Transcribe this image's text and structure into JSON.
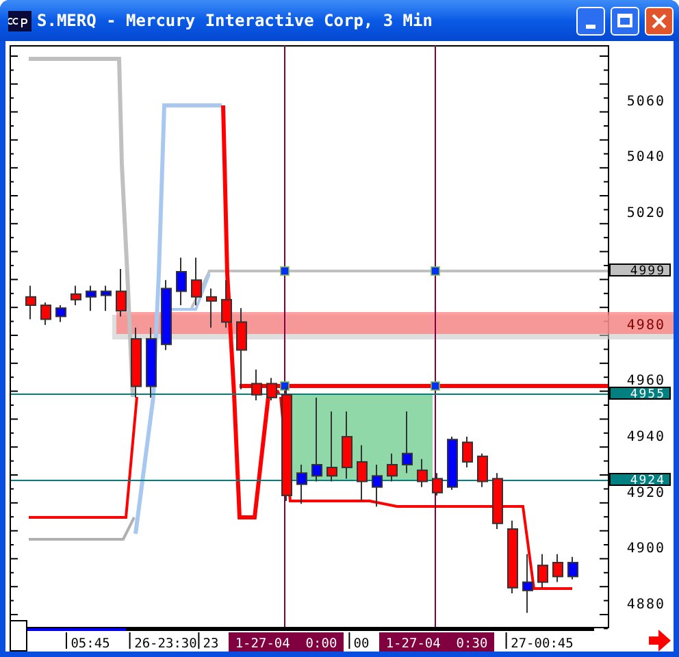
{
  "window": {
    "title": "S.MERQ - Mercury Interactive Corp, 3 Min"
  },
  "chart": {
    "chart_data": {
      "type": "candlestick",
      "categories": [
        null,
        null,
        null,
        null,
        "05:45",
        null,
        null,
        null,
        null,
        "26-23:30",
        null,
        null,
        "23",
        null,
        null,
        null,
        null,
        "1-27-04  0:00",
        null,
        null,
        null,
        null,
        "00",
        null,
        null,
        null,
        null,
        "1-27-04  0:30",
        null,
        null,
        null,
        null,
        null,
        null,
        "27-00:45",
        null,
        null
      ],
      "ohlc": [
        [
          4989,
          4993,
          4981,
          4986
        ],
        [
          4986,
          4987,
          4979,
          4981
        ],
        [
          4982,
          4986,
          4980,
          4985
        ],
        [
          4990,
          4993,
          4986,
          4988
        ],
        [
          4989,
          4993,
          4984,
          4991
        ],
        [
          4990,
          4993,
          4984,
          4991
        ],
        [
          4991,
          4999,
          4982,
          4984
        ],
        [
          4974,
          4978,
          4953,
          4957
        ],
        [
          4957,
          4978,
          4953,
          4974
        ],
        [
          4972,
          4995,
          4970,
          4992
        ],
        [
          4991,
          5003,
          4986,
          4998
        ],
        [
          4995,
          5003,
          4986,
          4989
        ],
        [
          4989,
          4992,
          4978,
          4988
        ],
        [
          4988,
          4995,
          4978,
          4980
        ],
        [
          4980,
          4985,
          4956,
          4970
        ],
        [
          4958,
          4963,
          4952,
          4954
        ],
        [
          4958,
          4960,
          4952,
          4953
        ],
        [
          4954,
          4957,
          4916,
          4918
        ],
        [
          4922,
          4929,
          4915,
          4926
        ],
        [
          4925,
          4953,
          4923,
          4929
        ],
        [
          4928,
          4948,
          4923,
          4925
        ],
        [
          4939,
          4948,
          4924,
          4928
        ],
        [
          4930,
          4936,
          4916,
          4923
        ],
        [
          4921,
          4929,
          4914,
          4925
        ],
        [
          4929,
          4933,
          4923,
          4925
        ],
        [
          4929,
          4948,
          4926,
          4933
        ],
        [
          4927,
          4931,
          4921,
          4923
        ],
        [
          4924,
          4926,
          4918,
          4919
        ],
        [
          4921,
          4939,
          4920,
          4938
        ],
        [
          4937,
          4939,
          4928,
          4930
        ],
        [
          4932,
          4933,
          4921,
          4923
        ],
        [
          4924,
          4926,
          4906,
          4908
        ],
        [
          4906,
          4909,
          4883,
          4885
        ],
        [
          4884,
          4897,
          4876,
          4887
        ],
        [
          4893,
          4897,
          4885,
          4887
        ],
        [
          4894,
          4897,
          4887,
          4889
        ],
        [
          4889,
          4896,
          4888,
          4894
        ]
      ],
      "ylim": [
        4871,
        5079
      ],
      "yticks": [
        {
          "value": 5060,
          "label": "5060"
        },
        {
          "value": 5040,
          "label": "5040"
        },
        {
          "value": 5020,
          "label": "5020"
        },
        {
          "value": 4980,
          "label": "4980"
        },
        {
          "value": 4960,
          "label": "4960"
        },
        {
          "value": 4940,
          "label": "4940"
        },
        {
          "value": 4920,
          "label": "4920"
        },
        {
          "value": 4900,
          "label": "4900"
        },
        {
          "value": 4880,
          "label": "4880"
        }
      ]
    },
    "time_labels_highlighted": [
      false,
      false,
      false,
      true,
      false,
      true,
      false
    ],
    "price_tags": [
      {
        "text": "4999",
        "color": "#c0c0c0"
      },
      {
        "text": "4955",
        "color": "#008080"
      },
      {
        "text": "4924",
        "color": "#008080"
      }
    ]
  }
}
